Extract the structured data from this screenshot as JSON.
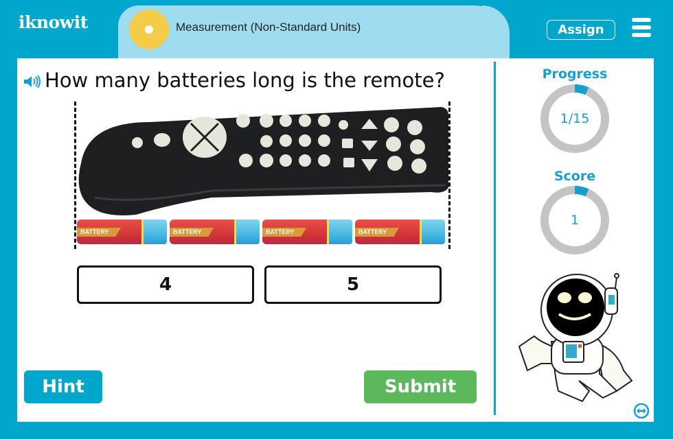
{
  "header": {
    "logo_text": "iknowit",
    "topic": "Measurement (Non-Standard Units)",
    "assign_label": "Assign",
    "menu_icon": "hamburger-menu-icon"
  },
  "question": {
    "speaker_icon": "speaker-icon",
    "text": "How many batteries long is the remote?",
    "image": {
      "object": "remote control",
      "battery_label": "BATTERY",
      "battery_count": 4
    }
  },
  "answers": [
    {
      "label": "4"
    },
    {
      "label": "5"
    }
  ],
  "buttons": {
    "hint": "Hint",
    "submit": "Submit"
  },
  "sidebar": {
    "progress": {
      "label": "Progress",
      "text": "1/15",
      "current": 1,
      "total": 15
    },
    "score": {
      "label": "Score",
      "text": "1",
      "fraction": 0.0667
    },
    "mascot": "astronaut",
    "swap_icon": "swap-layout-icon"
  },
  "colors": {
    "brand": "#00a6cc",
    "title_pill": "#9fdcef",
    "sun": "#f4cd48",
    "submit": "#5cb85c",
    "ring_track": "#c4c4c4",
    "ring_fill": "#1a9fcc"
  }
}
